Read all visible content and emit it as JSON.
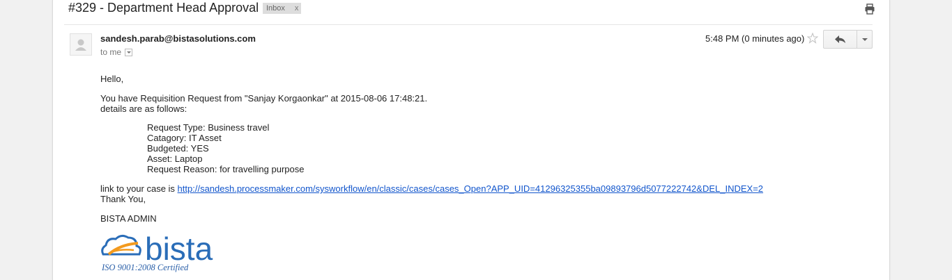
{
  "subject": "#329 - Department Head Approval",
  "label": {
    "name": "Inbox",
    "remove": "x"
  },
  "sender": "sandesh.parab@bistasolutions.com",
  "recipient_line": "to me",
  "timestamp": "5:48 PM (0 minutes ago)",
  "icons": {
    "print": "print-icon",
    "star": "star-icon",
    "reply": "reply-icon",
    "more": "chevron-down-icon",
    "avatar": "person-icon"
  },
  "body": {
    "greeting": "Hello,",
    "intro_line1": "You have Requisition Request from \"Sanjay Korgaonkar\" at 2015-08-06 17:48:21.",
    "intro_line2": "details are as follows:",
    "details": [
      "Request Type: Business travel",
      "Catagory: IT Asset",
      "Budgeted: YES",
      "Asset: Laptop",
      "Request Reason: for travelling purpose"
    ],
    "link_prefix": "link to your case is ",
    "link_url": "http://sandesh.processmaker.com/sysworkflow/en/classic/cases/cases_Open?APP_UID=41296325355ba09893796d5077222742&DEL_INDEX=2",
    "thanks": "Thank You,",
    "signature": "BISTA ADMIN"
  },
  "logo": {
    "wordmark": "bista",
    "certification": "ISO 9001:2008 Certified"
  },
  "colors": {
    "link": "#1155cc",
    "logo_blue": "#2a6db8",
    "logo_orange": "#f39a1e"
  }
}
